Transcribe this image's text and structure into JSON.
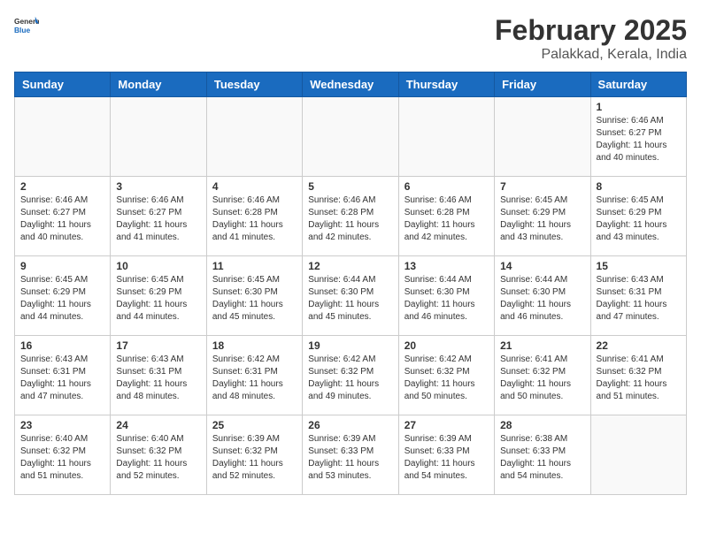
{
  "header": {
    "logo_general": "General",
    "logo_blue": "Blue",
    "month_year": "February 2025",
    "location": "Palakkad, Kerala, India"
  },
  "weekdays": [
    "Sunday",
    "Monday",
    "Tuesday",
    "Wednesday",
    "Thursday",
    "Friday",
    "Saturday"
  ],
  "weeks": [
    [
      {
        "day": "",
        "info": ""
      },
      {
        "day": "",
        "info": ""
      },
      {
        "day": "",
        "info": ""
      },
      {
        "day": "",
        "info": ""
      },
      {
        "day": "",
        "info": ""
      },
      {
        "day": "",
        "info": ""
      },
      {
        "day": "1",
        "info": "Sunrise: 6:46 AM\nSunset: 6:27 PM\nDaylight: 11 hours and 40 minutes."
      }
    ],
    [
      {
        "day": "2",
        "info": "Sunrise: 6:46 AM\nSunset: 6:27 PM\nDaylight: 11 hours and 40 minutes."
      },
      {
        "day": "3",
        "info": "Sunrise: 6:46 AM\nSunset: 6:27 PM\nDaylight: 11 hours and 41 minutes."
      },
      {
        "day": "4",
        "info": "Sunrise: 6:46 AM\nSunset: 6:28 PM\nDaylight: 11 hours and 41 minutes."
      },
      {
        "day": "5",
        "info": "Sunrise: 6:46 AM\nSunset: 6:28 PM\nDaylight: 11 hours and 42 minutes."
      },
      {
        "day": "6",
        "info": "Sunrise: 6:46 AM\nSunset: 6:28 PM\nDaylight: 11 hours and 42 minutes."
      },
      {
        "day": "7",
        "info": "Sunrise: 6:45 AM\nSunset: 6:29 PM\nDaylight: 11 hours and 43 minutes."
      },
      {
        "day": "8",
        "info": "Sunrise: 6:45 AM\nSunset: 6:29 PM\nDaylight: 11 hours and 43 minutes."
      }
    ],
    [
      {
        "day": "9",
        "info": "Sunrise: 6:45 AM\nSunset: 6:29 PM\nDaylight: 11 hours and 44 minutes."
      },
      {
        "day": "10",
        "info": "Sunrise: 6:45 AM\nSunset: 6:29 PM\nDaylight: 11 hours and 44 minutes."
      },
      {
        "day": "11",
        "info": "Sunrise: 6:45 AM\nSunset: 6:30 PM\nDaylight: 11 hours and 45 minutes."
      },
      {
        "day": "12",
        "info": "Sunrise: 6:44 AM\nSunset: 6:30 PM\nDaylight: 11 hours and 45 minutes."
      },
      {
        "day": "13",
        "info": "Sunrise: 6:44 AM\nSunset: 6:30 PM\nDaylight: 11 hours and 46 minutes."
      },
      {
        "day": "14",
        "info": "Sunrise: 6:44 AM\nSunset: 6:30 PM\nDaylight: 11 hours and 46 minutes."
      },
      {
        "day": "15",
        "info": "Sunrise: 6:43 AM\nSunset: 6:31 PM\nDaylight: 11 hours and 47 minutes."
      }
    ],
    [
      {
        "day": "16",
        "info": "Sunrise: 6:43 AM\nSunset: 6:31 PM\nDaylight: 11 hours and 47 minutes."
      },
      {
        "day": "17",
        "info": "Sunrise: 6:43 AM\nSunset: 6:31 PM\nDaylight: 11 hours and 48 minutes."
      },
      {
        "day": "18",
        "info": "Sunrise: 6:42 AM\nSunset: 6:31 PM\nDaylight: 11 hours and 48 minutes."
      },
      {
        "day": "19",
        "info": "Sunrise: 6:42 AM\nSunset: 6:32 PM\nDaylight: 11 hours and 49 minutes."
      },
      {
        "day": "20",
        "info": "Sunrise: 6:42 AM\nSunset: 6:32 PM\nDaylight: 11 hours and 50 minutes."
      },
      {
        "day": "21",
        "info": "Sunrise: 6:41 AM\nSunset: 6:32 PM\nDaylight: 11 hours and 50 minutes."
      },
      {
        "day": "22",
        "info": "Sunrise: 6:41 AM\nSunset: 6:32 PM\nDaylight: 11 hours and 51 minutes."
      }
    ],
    [
      {
        "day": "23",
        "info": "Sunrise: 6:40 AM\nSunset: 6:32 PM\nDaylight: 11 hours and 51 minutes."
      },
      {
        "day": "24",
        "info": "Sunrise: 6:40 AM\nSunset: 6:32 PM\nDaylight: 11 hours and 52 minutes."
      },
      {
        "day": "25",
        "info": "Sunrise: 6:39 AM\nSunset: 6:32 PM\nDaylight: 11 hours and 52 minutes."
      },
      {
        "day": "26",
        "info": "Sunrise: 6:39 AM\nSunset: 6:33 PM\nDaylight: 11 hours and 53 minutes."
      },
      {
        "day": "27",
        "info": "Sunrise: 6:39 AM\nSunset: 6:33 PM\nDaylight: 11 hours and 54 minutes."
      },
      {
        "day": "28",
        "info": "Sunrise: 6:38 AM\nSunset: 6:33 PM\nDaylight: 11 hours and 54 minutes."
      },
      {
        "day": "",
        "info": ""
      }
    ]
  ]
}
